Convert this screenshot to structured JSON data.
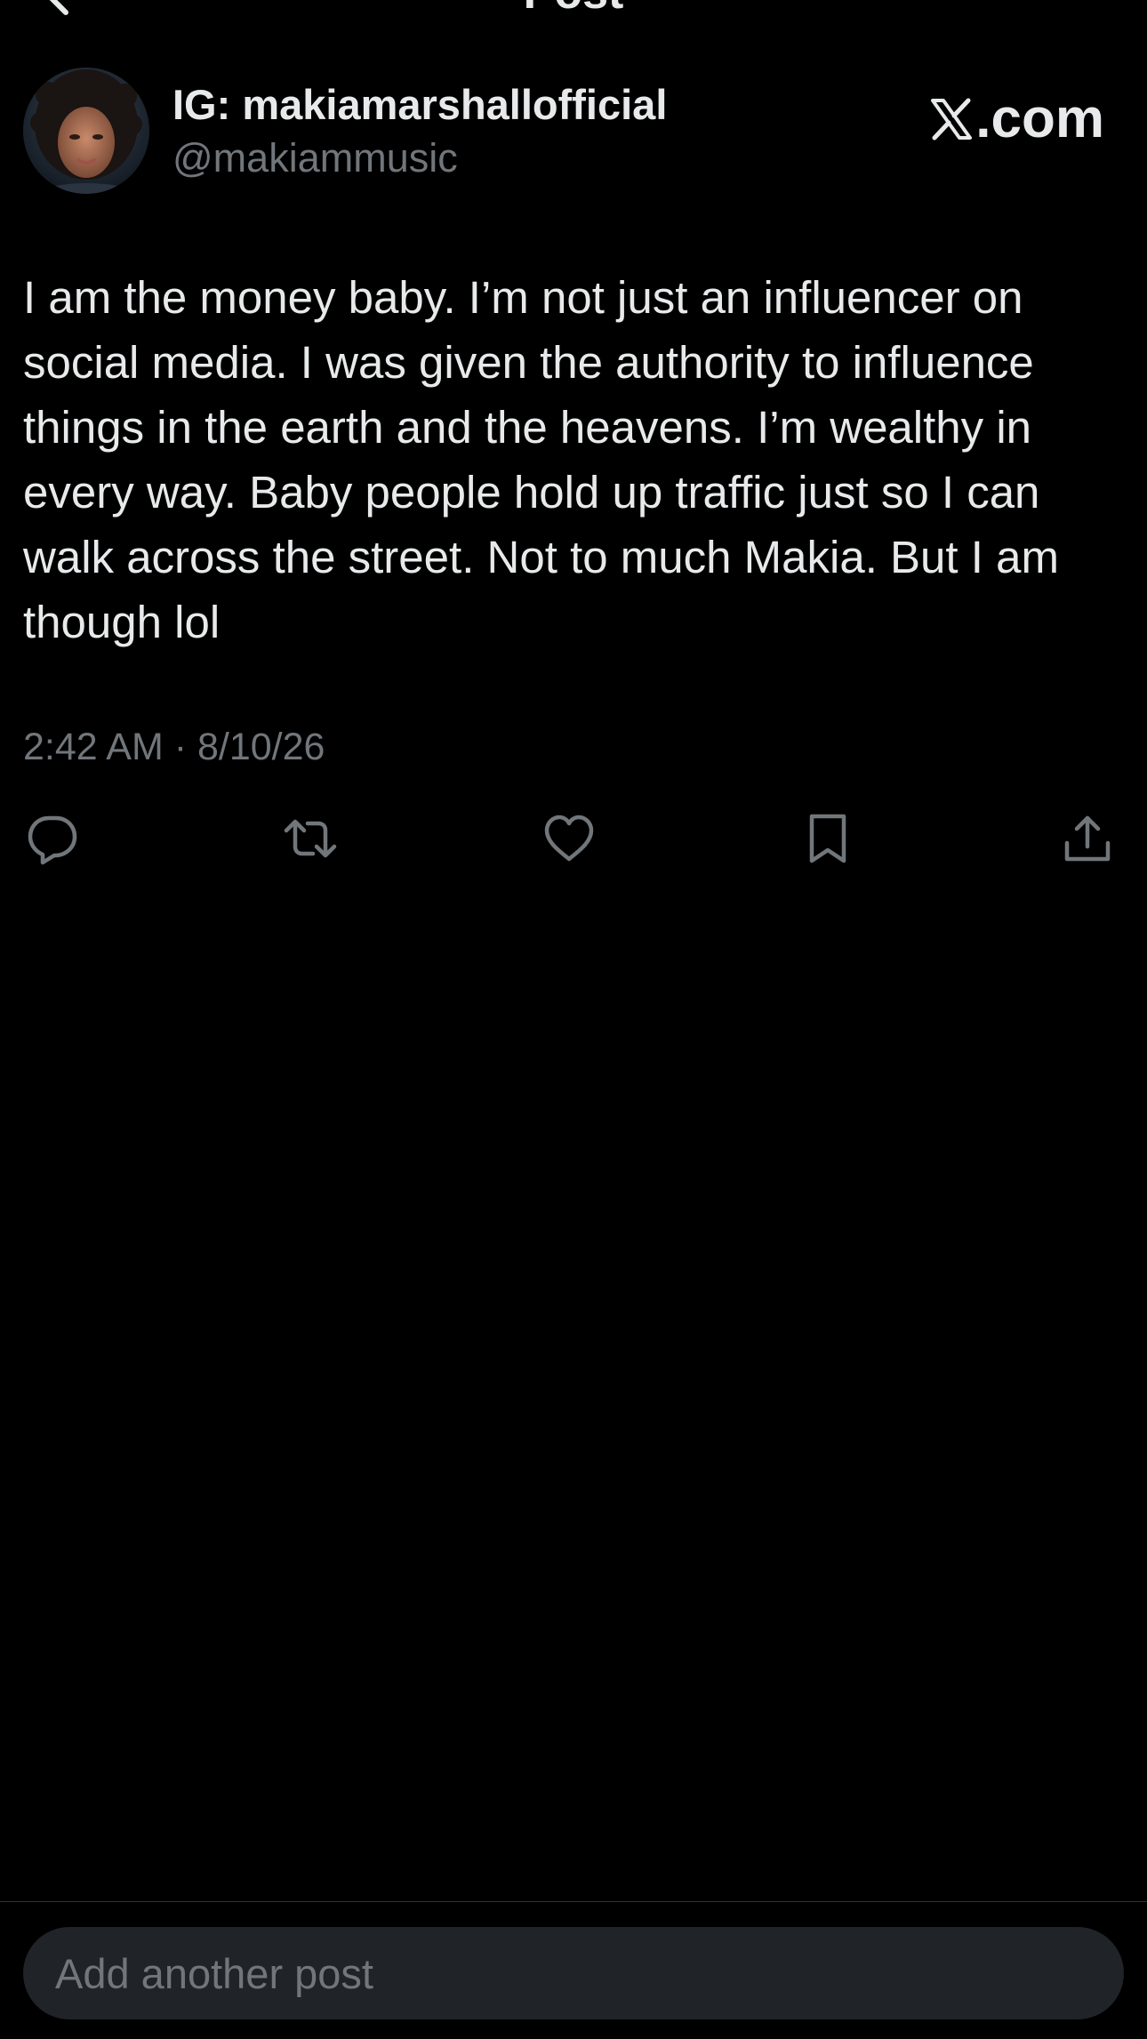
{
  "nav": {
    "title": "Post",
    "back_icon": "chevron-left-icon"
  },
  "author": {
    "display_name": "IG: makiamarshallofficial",
    "handle": "@makiammusic",
    "avatar": "profile-photo"
  },
  "watermark": {
    "logo": "x-logo-icon",
    "text": ".com"
  },
  "post": {
    "text": "I am the money baby. I’m not just an influencer on social media. I was given the authority to influence things in the earth and the heavens. I’m wealthy in every way. Baby people hold up traffic just so I can walk across the street. Not to much Makia. But I am though lol",
    "timestamp": "2:42 AM · 8/10/26"
  },
  "actions": [
    {
      "name": "reply",
      "icon": "reply-icon"
    },
    {
      "name": "repost",
      "icon": "repost-icon"
    },
    {
      "name": "like",
      "icon": "heart-icon"
    },
    {
      "name": "bookmark",
      "icon": "bookmark-icon"
    },
    {
      "name": "share",
      "icon": "share-icon"
    }
  ],
  "composer": {
    "placeholder": "Add another post"
  },
  "colors": {
    "background": "#000000",
    "text_primary": "#e7e9ea",
    "text_secondary": "#71767b",
    "composer_bg": "#202327",
    "divider": "#2f3336"
  }
}
